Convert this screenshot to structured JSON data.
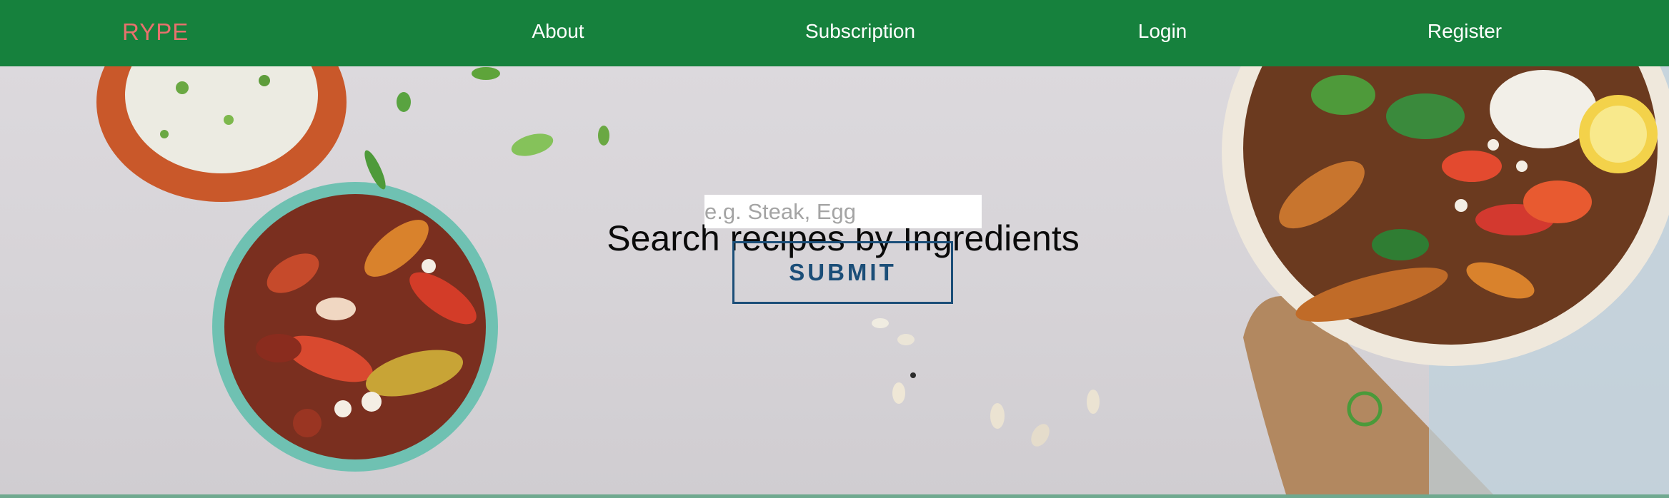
{
  "nav": {
    "brand": "RYPE",
    "links": [
      "About",
      "Subscription",
      "Login",
      "Register"
    ]
  },
  "hero": {
    "title": "Search recipes by Ingredients",
    "search_placeholder": "e.g. Steak, Egg",
    "submit_label": "SUBMIT"
  },
  "colors": {
    "nav_bg": "#16813d",
    "brand": "#e8716d",
    "button_border": "#1b4e78"
  }
}
